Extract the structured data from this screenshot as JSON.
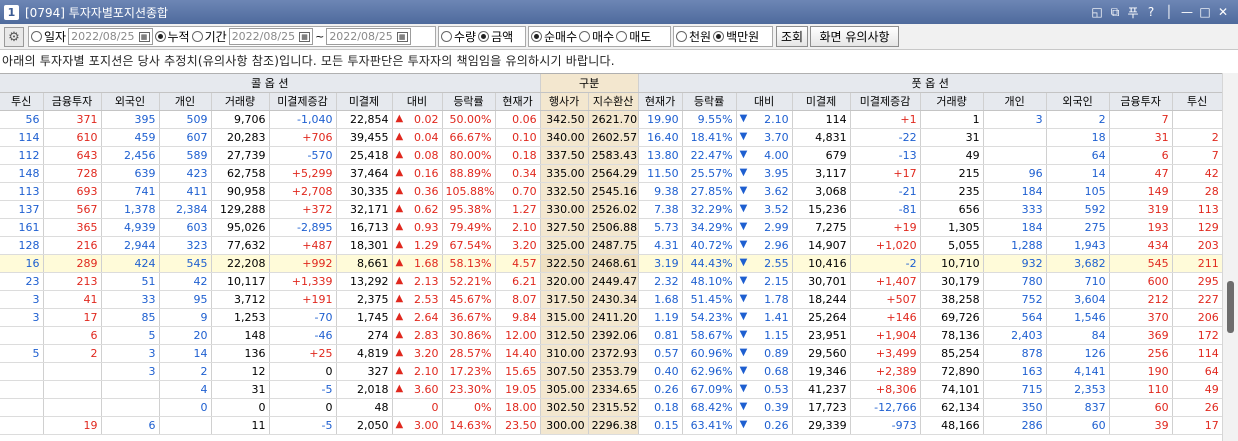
{
  "window": {
    "number": "1",
    "title": "[0794] 투자자별포지션종합",
    "controls": [
      "◱",
      "⧉",
      "푸",
      "?",
      "│",
      "—",
      "□",
      "✕"
    ]
  },
  "toolbar": {
    "mode_daily": "일자",
    "mode_cumulative": "누적",
    "mode_period": "기간",
    "date_single": "2022/08/25",
    "date_from": "2022/08/25",
    "date_tilde": "~",
    "date_to": "2022/08/25",
    "qty": "수량",
    "amount": "금액",
    "net_buy": "순매수",
    "buy": "매수",
    "sell": "매도",
    "thousand_won": "천원",
    "million_won": "백만원",
    "query_button": "조회",
    "notice_button": "화면 유의사항"
  },
  "notice": "아래의 투자자별 포지션은 당사 추정치(유의사항 참조)입니다. 모든 투자판단은 투자자의 책임임을 유의하시기 바랍니다.",
  "table": {
    "group_headers": {
      "call": "콜 옵 션",
      "center": "구분",
      "put": "풋 옵 션"
    },
    "columns": [
      "투신",
      "금융투자",
      "외국인",
      "개인",
      "거래량",
      "미결제증감",
      "미결제",
      "대비",
      "등락률",
      "현재가",
      "행사가",
      "지수환산",
      "현재가",
      "등락률",
      "대비",
      "미결제",
      "미결제증감",
      "거래량",
      "개인",
      "외국인",
      "금융투자",
      "투신"
    ],
    "rows": [
      {
        "c_trust": "56",
        "c_fin": "371",
        "c_foreign": "395",
        "c_indiv": "509",
        "c_vol": "9,706",
        "c_oi_chg": "-1,040",
        "c_oi": "22,854",
        "c_diff": "0.02",
        "c_rate": "50.00%",
        "c_price": "0.06",
        "strike": "342.50",
        "index": "2621.70",
        "p_price": "19.90",
        "p_rate": "9.55%",
        "p_diff": "2.10",
        "p_oi": "114",
        "p_oi_chg": "+1",
        "p_vol": "1",
        "p_indiv": "3",
        "p_foreign": "2",
        "p_fin": "7",
        "p_trust": ""
      },
      {
        "c_trust": "114",
        "c_fin": "610",
        "c_foreign": "459",
        "c_indiv": "607",
        "c_vol": "20,283",
        "c_oi_chg": "+706",
        "c_oi": "39,455",
        "c_diff": "0.04",
        "c_rate": "66.67%",
        "c_price": "0.10",
        "strike": "340.00",
        "index": "2602.57",
        "p_price": "16.40",
        "p_rate": "18.41%",
        "p_diff": "3.70",
        "p_oi": "4,831",
        "p_oi_chg": "-22",
        "p_vol": "31",
        "p_indiv": "",
        "p_foreign": "18",
        "p_fin": "31",
        "p_trust": "2"
      },
      {
        "c_trust": "112",
        "c_fin": "643",
        "c_foreign": "2,456",
        "c_indiv": "589",
        "c_vol": "27,739",
        "c_oi_chg": "-570",
        "c_oi": "25,418",
        "c_diff": "0.08",
        "c_rate": "80.00%",
        "c_price": "0.18",
        "strike": "337.50",
        "index": "2583.43",
        "p_price": "13.80",
        "p_rate": "22.47%",
        "p_diff": "4.00",
        "p_oi": "679",
        "p_oi_chg": "-13",
        "p_vol": "49",
        "p_indiv": "",
        "p_foreign": "64",
        "p_fin": "6",
        "p_trust": "7"
      },
      {
        "c_trust": "148",
        "c_fin": "728",
        "c_foreign": "639",
        "c_indiv": "423",
        "c_vol": "62,758",
        "c_oi_chg": "+5,299",
        "c_oi": "37,464",
        "c_diff": "0.16",
        "c_rate": "88.89%",
        "c_price": "0.34",
        "strike": "335.00",
        "index": "2564.29",
        "p_price": "11.50",
        "p_rate": "25.57%",
        "p_diff": "3.95",
        "p_oi": "3,117",
        "p_oi_chg": "+17",
        "p_vol": "215",
        "p_indiv": "96",
        "p_foreign": "14",
        "p_fin": "47",
        "p_trust": "42"
      },
      {
        "c_trust": "113",
        "c_fin": "693",
        "c_foreign": "741",
        "c_indiv": "411",
        "c_vol": "90,958",
        "c_oi_chg": "+2,708",
        "c_oi": "30,335",
        "c_diff": "0.36",
        "c_rate": "105.88%",
        "c_price": "0.70",
        "strike": "332.50",
        "index": "2545.16",
        "p_price": "9.38",
        "p_rate": "27.85%",
        "p_diff": "3.62",
        "p_oi": "3,068",
        "p_oi_chg": "-21",
        "p_vol": "235",
        "p_indiv": "184",
        "p_foreign": "105",
        "p_fin": "149",
        "p_trust": "28"
      },
      {
        "c_trust": "137",
        "c_fin": "567",
        "c_foreign": "1,378",
        "c_indiv": "2,384",
        "c_vol": "129,288",
        "c_oi_chg": "+372",
        "c_oi": "32,171",
        "c_diff": "0.62",
        "c_rate": "95.38%",
        "c_price": "1.27",
        "strike": "330.00",
        "index": "2526.02",
        "p_price": "7.38",
        "p_rate": "32.29%",
        "p_diff": "3.52",
        "p_oi": "15,236",
        "p_oi_chg": "-81",
        "p_vol": "656",
        "p_indiv": "333",
        "p_foreign": "592",
        "p_fin": "319",
        "p_trust": "113"
      },
      {
        "c_trust": "161",
        "c_fin": "365",
        "c_foreign": "4,939",
        "c_indiv": "603",
        "c_vol": "95,026",
        "c_oi_chg": "-2,895",
        "c_oi": "16,713",
        "c_diff": "0.93",
        "c_rate": "79.49%",
        "c_price": "2.10",
        "strike": "327.50",
        "index": "2506.88",
        "p_price": "5.73",
        "p_rate": "34.29%",
        "p_diff": "2.99",
        "p_oi": "7,275",
        "p_oi_chg": "+19",
        "p_vol": "1,305",
        "p_indiv": "184",
        "p_foreign": "275",
        "p_fin": "193",
        "p_trust": "129"
      },
      {
        "c_trust": "128",
        "c_fin": "216",
        "c_foreign": "2,944",
        "c_indiv": "323",
        "c_vol": "77,632",
        "c_oi_chg": "+487",
        "c_oi": "18,301",
        "c_diff": "1.29",
        "c_rate": "67.54%",
        "c_price": "3.20",
        "strike": "325.00",
        "index": "2487.75",
        "p_price": "4.31",
        "p_rate": "40.72%",
        "p_diff": "2.96",
        "p_oi": "14,907",
        "p_oi_chg": "+1,020",
        "p_vol": "5,055",
        "p_indiv": "1,288",
        "p_foreign": "1,943",
        "p_fin": "434",
        "p_trust": "203"
      },
      {
        "c_trust": "16",
        "c_fin": "289",
        "c_foreign": "424",
        "c_indiv": "545",
        "c_vol": "22,208",
        "c_oi_chg": "+992",
        "c_oi": "8,661",
        "c_diff": "1.68",
        "c_rate": "58.13%",
        "c_price": "4.57",
        "strike": "322.50",
        "index": "2468.61",
        "p_price": "3.19",
        "p_rate": "44.43%",
        "p_diff": "2.55",
        "p_oi": "10,416",
        "p_oi_chg": "-2",
        "p_vol": "10,710",
        "p_indiv": "932",
        "p_foreign": "3,682",
        "p_fin": "545",
        "p_trust": "211"
      },
      {
        "c_trust": "23",
        "c_fin": "213",
        "c_foreign": "51",
        "c_indiv": "42",
        "c_vol": "10,117",
        "c_oi_chg": "+1,339",
        "c_oi": "13,292",
        "c_diff": "2.13",
        "c_rate": "52.21%",
        "c_price": "6.21",
        "strike": "320.00",
        "index": "2449.47",
        "p_price": "2.32",
        "p_rate": "48.10%",
        "p_diff": "2.15",
        "p_oi": "30,701",
        "p_oi_chg": "+1,407",
        "p_vol": "30,179",
        "p_indiv": "780",
        "p_foreign": "710",
        "p_fin": "600",
        "p_trust": "295"
      },
      {
        "c_trust": "3",
        "c_fin": "41",
        "c_foreign": "33",
        "c_indiv": "95",
        "c_vol": "3,712",
        "c_oi_chg": "+191",
        "c_oi": "2,375",
        "c_diff": "2.53",
        "c_rate": "45.67%",
        "c_price": "8.07",
        "strike": "317.50",
        "index": "2430.34",
        "p_price": "1.68",
        "p_rate": "51.45%",
        "p_diff": "1.78",
        "p_oi": "18,244",
        "p_oi_chg": "+507",
        "p_vol": "38,258",
        "p_indiv": "752",
        "p_foreign": "3,604",
        "p_fin": "212",
        "p_trust": "227"
      },
      {
        "c_trust": "3",
        "c_fin": "17",
        "c_foreign": "85",
        "c_indiv": "9",
        "c_vol": "1,253",
        "c_oi_chg": "-70",
        "c_oi": "1,745",
        "c_diff": "2.64",
        "c_rate": "36.67%",
        "c_price": "9.84",
        "strike": "315.00",
        "index": "2411.20",
        "p_price": "1.19",
        "p_rate": "54.23%",
        "p_diff": "1.41",
        "p_oi": "25,264",
        "p_oi_chg": "+146",
        "p_vol": "69,726",
        "p_indiv": "564",
        "p_foreign": "1,546",
        "p_fin": "370",
        "p_trust": "206"
      },
      {
        "c_trust": "",
        "c_fin": "6",
        "c_foreign": "5",
        "c_indiv": "20",
        "c_vol": "148",
        "c_oi_chg": "-46",
        "c_oi": "274",
        "c_diff": "2.83",
        "c_rate": "30.86%",
        "c_price": "12.00",
        "strike": "312.50",
        "index": "2392.06",
        "p_price": "0.81",
        "p_rate": "58.67%",
        "p_diff": "1.15",
        "p_oi": "23,951",
        "p_oi_chg": "+1,904",
        "p_vol": "78,136",
        "p_indiv": "2,403",
        "p_foreign": "84",
        "p_fin": "369",
        "p_trust": "172"
      },
      {
        "c_trust": "5",
        "c_fin": "2",
        "c_foreign": "3",
        "c_indiv": "14",
        "c_vol": "136",
        "c_oi_chg": "+25",
        "c_oi": "4,819",
        "c_diff": "3.20",
        "c_rate": "28.57%",
        "c_price": "14.40",
        "strike": "310.00",
        "index": "2372.93",
        "p_price": "0.57",
        "p_rate": "60.96%",
        "p_diff": "0.89",
        "p_oi": "29,560",
        "p_oi_chg": "+3,499",
        "p_vol": "85,254",
        "p_indiv": "878",
        "p_foreign": "126",
        "p_fin": "256",
        "p_trust": "114"
      },
      {
        "c_trust": "",
        "c_fin": "",
        "c_foreign": "3",
        "c_indiv": "2",
        "c_vol": "12",
        "c_oi_chg": "0",
        "c_oi": "327",
        "c_diff": "2.10",
        "c_rate": "17.23%",
        "c_price": "15.65",
        "strike": "307.50",
        "index": "2353.79",
        "p_price": "0.40",
        "p_rate": "62.96%",
        "p_diff": "0.68",
        "p_oi": "19,346",
        "p_oi_chg": "+2,389",
        "p_vol": "72,890",
        "p_indiv": "163",
        "p_foreign": "4,141",
        "p_fin": "190",
        "p_trust": "64"
      },
      {
        "c_trust": "",
        "c_fin": "",
        "c_foreign": "",
        "c_indiv": "4",
        "c_vol": "31",
        "c_oi_chg": "-5",
        "c_oi": "2,018",
        "c_diff": "3.60",
        "c_rate": "23.30%",
        "c_price": "19.05",
        "strike": "305.00",
        "index": "2334.65",
        "p_price": "0.26",
        "p_rate": "67.09%",
        "p_diff": "0.53",
        "p_oi": "41,237",
        "p_oi_chg": "+8,306",
        "p_vol": "74,101",
        "p_indiv": "715",
        "p_foreign": "2,353",
        "p_fin": "110",
        "p_trust": "49"
      },
      {
        "c_trust": "",
        "c_fin": "",
        "c_foreign": "",
        "c_indiv": "0",
        "c_vol": "0",
        "c_oi_chg": "0",
        "c_oi": "48",
        "c_diff": "0",
        "c_rate": "0%",
        "c_price": "18.00",
        "strike": "302.50",
        "index": "2315.52",
        "p_price": "0.18",
        "p_rate": "68.42%",
        "p_diff": "0.39",
        "p_oi": "17,723",
        "p_oi_chg": "-12,766",
        "p_vol": "62,134",
        "p_indiv": "350",
        "p_foreign": "837",
        "p_fin": "60",
        "p_trust": "26"
      },
      {
        "c_trust": "",
        "c_fin": "19",
        "c_foreign": "6",
        "c_indiv": "",
        "c_vol": "11",
        "c_oi_chg": "-5",
        "c_oi": "2,050",
        "c_diff": "3.00",
        "c_rate": "14.63%",
        "c_price": "23.50",
        "strike": "300.00",
        "index": "2296.38",
        "p_price": "0.15",
        "p_rate": "63.41%",
        "p_diff": "0.26",
        "p_oi": "29,339",
        "p_oi_chg": "-973",
        "p_vol": "48,166",
        "p_indiv": "286",
        "p_foreign": "60",
        "p_fin": "39",
        "p_trust": "17"
      }
    ]
  },
  "colors": {
    "up": "#e0281e",
    "down": "#1e5fd0",
    "title_bar": "#5a74a6",
    "strike_bg": "#f3e7cf",
    "highlight_row": "#fffbd9"
  },
  "icons": {
    "gear": "gear-icon",
    "calendar": "calendar-icon",
    "up": "triangle-up-icon",
    "down": "triangle-down-icon"
  }
}
